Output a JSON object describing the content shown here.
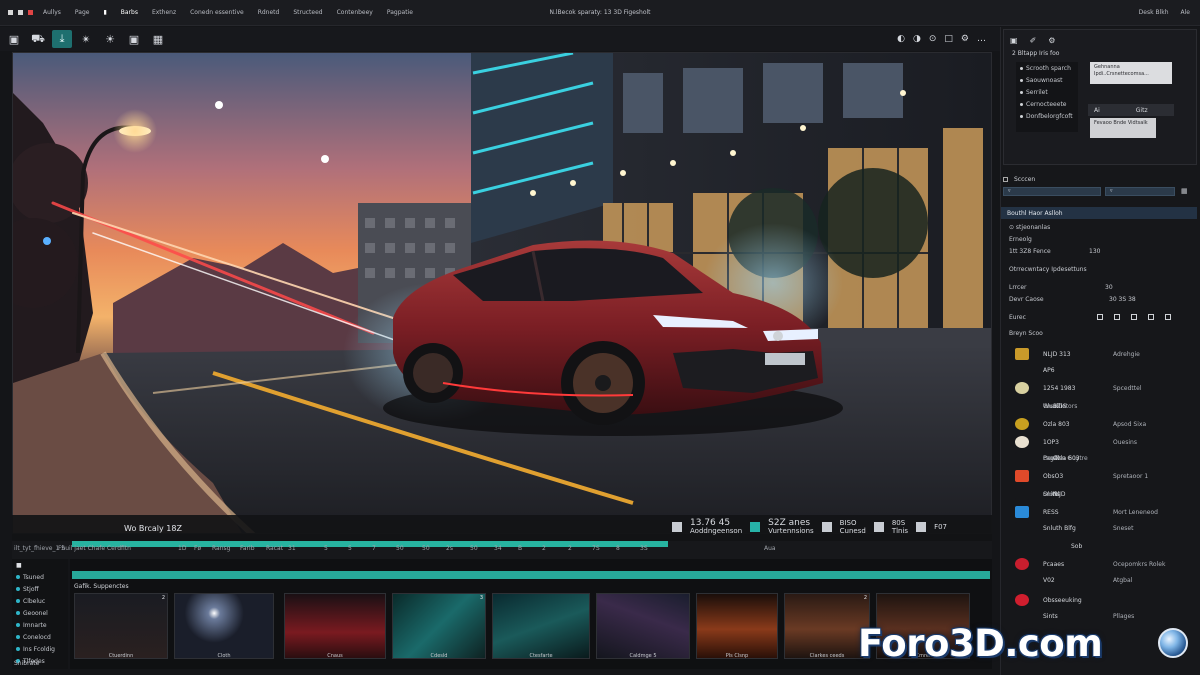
{
  "app": {
    "title": "N.lBecok sparaty: 13 3D Figesholt",
    "menu": [
      "Aullys",
      "Page",
      "",
      "Barbs",
      "Exthenz",
      "Conedn essentive",
      "Rdnetd",
      "Structeed",
      "Contenbeey",
      "Pagpatie"
    ],
    "menu_active_index": 3,
    "right": [
      "Desk Blkh",
      "Ale"
    ]
  },
  "toolbar": {
    "right": [
      "◐",
      "◑",
      "⊙",
      "□",
      "⚙",
      "…"
    ]
  },
  "transport": {
    "title": "Wo Brcaly 18Z",
    "time": "13.76 45",
    "time_sub": "Aoddngeenson",
    "size": "S2Z anes",
    "size_sub": "Vurtennsions",
    "g1_top": "BISO",
    "g1_bot": "Cunesd",
    "g2_top": "80S",
    "g2_bot": "Tlnis",
    "end": "F07"
  },
  "ruler": {
    "left": "ilt_tyt_fhieve_1 S",
    "left2": "Fhuil jaet Chafe Cerdfitn",
    "ticks": [
      "1D",
      "Fø",
      "Ransg",
      "Farib",
      "Racat",
      "31",
      "5",
      "5",
      "7",
      "50",
      "50",
      "2s",
      "50",
      "34",
      "B",
      "2",
      "2",
      "7S",
      "8",
      "3S"
    ],
    "mid": "Aua"
  },
  "layers": {
    "header": "■",
    "items": [
      "Tsuned",
      "Stjoff",
      "Clbeluc",
      "Geoonel",
      "Imnarte",
      "Conelocd",
      "Ins Fcoldig",
      "Tlfedes"
    ],
    "footer": "Snibrate"
  },
  "strip": {
    "title": "Gafik. Suppenctes",
    "thumbs": [
      {
        "num": "2",
        "cap": "Ctuerdinn"
      },
      {
        "num": "",
        "cap": "Cloth"
      },
      {
        "num": "",
        "cap": "Cnaus"
      },
      {
        "num": "3",
        "cap": "Cdesld"
      },
      {
        "num": "",
        "cap": "Ctesfarte"
      },
      {
        "num": "",
        "cap": "Caldmge 5"
      },
      {
        "num": "",
        "cap": "Pls Clsnp"
      },
      {
        "num": "2",
        "cap": "Clarkes ceeds"
      },
      {
        "num": "",
        "cap": "Cmrel"
      }
    ]
  },
  "right": {
    "top_title": "2 Bltapp Iris foo",
    "list": [
      "Scrooth sparch",
      "Saouwnoast",
      "Serrilet",
      "Cernocteeete",
      "Donfbelorgfcoft"
    ],
    "tooltip": "Gehnanna Ipdi..Crsnettecomsa...",
    "row_label": "Ai",
    "row_val": "Gitz",
    "box": "Fevaoo Bnde Vidtsalk",
    "tabs_label": "Scccen",
    "section1": "Bouthl Haor Aslloh",
    "rows": [
      {
        "label": "⊙ stjeonanlas",
        "val": ""
      },
      {
        "label": "Erneolg",
        "val": ""
      },
      {
        "label": "1tt 3Z8  Fence",
        "val": "130"
      },
      {
        "label": "Otrrecwntacy Ipdesettuns",
        "val": ""
      },
      {
        "label": "Lrrcer",
        "val": "30"
      },
      {
        "label": "Devr Caose",
        "val": "30  3S  38"
      },
      {
        "label": "Eurec",
        "val": ""
      },
      {
        "label": "Breyn Scoo",
        "val": ""
      }
    ],
    "materials": [
      {
        "label": "NLJD 313",
        "sub": "AP6",
        "val": "Adrehgie",
        "color": "#c99a2a"
      },
      {
        "label": "1254 1983",
        "sub": "",
        "val": "Spcedttel",
        "color": "#d8d0a0"
      },
      {
        "label": "3ZIS",
        "sub": "Wuoh",
        "val": "Ghaxlietors",
        "color": "#c8a020"
      },
      {
        "label": "Ozla 803",
        "sub": "",
        "val": "Apsod Sixa",
        "color": "#f0a030"
      },
      {
        "label": "1OP3",
        "sub": "",
        "val": "Ouesins",
        "color": "#e8e0d0"
      },
      {
        "label": "Ozla 603",
        "sub": "Pagal",
        "val": "Ocefisn Guytre",
        "color": "#d06040"
      },
      {
        "label": "ObsO3",
        "sub": "",
        "val": "Spretaoor 1",
        "color": "#e04a2a"
      },
      {
        "label": "NlJD",
        "sub": "Snith",
        "val": "Olons",
        "color": "#d83a2a"
      },
      {
        "label": "RESS",
        "sub": "",
        "val": "Mort Leneneod",
        "color": "#2a8ad8"
      },
      {
        "label": "Snluth Blfg",
        "sub": "",
        "val": "Sneset",
        "color": "#2a2a2a"
      },
      {
        "label": "Sob",
        "sub": "",
        "val": "",
        "color": "#1a1a1a"
      },
      {
        "label": "Pcaaes",
        "sub": "",
        "val": "Ocepomkrs Rolek",
        "color": "#c81e2e"
      },
      {
        "label": "V02",
        "sub": "",
        "val": "Atgbal",
        "color": "#1a1a1a"
      },
      {
        "label": "Obsseeuking",
        "sub": "",
        "val": "",
        "color": "#d01e2e"
      },
      {
        "label": "Sints",
        "sub": "",
        "val": "Pllages",
        "color": "#1a1a1a"
      }
    ]
  },
  "watermark": "Foro3D.com"
}
